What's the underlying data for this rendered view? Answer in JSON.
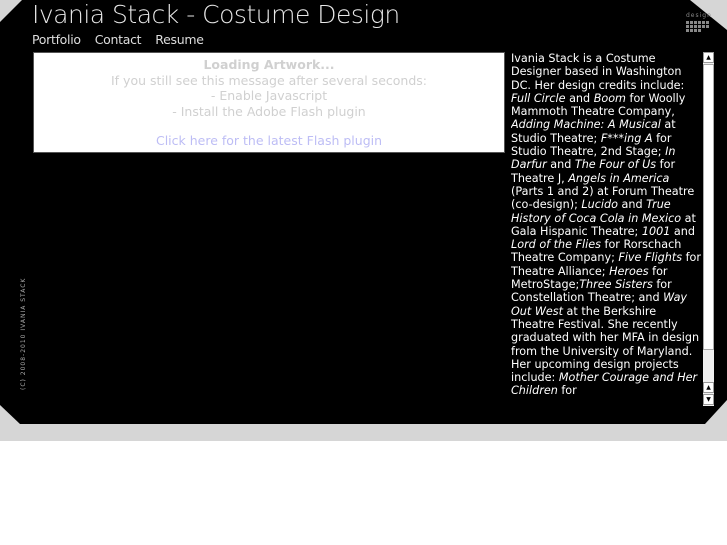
{
  "header": {
    "title": "Ivania Stack - Costume Design",
    "nav": [
      "Portfolio",
      "Contact",
      "Resume"
    ],
    "logo_text": "design"
  },
  "flash": {
    "heading": "Loading Artwork...",
    "line1": "If you still see this message after several seconds:",
    "line2": "- Enable Javascript",
    "line3": "- Install the Adobe Flash plugin",
    "link": "Click here for the latest Flash plugin"
  },
  "copyright": "(C) 2008-2010 IVANIA STACK",
  "bio": [
    {
      "t": "Ivania Stack is a Costume Designer based in Washington DC. Her design credits include: ",
      "i": false
    },
    {
      "t": "Full Circle",
      "i": true
    },
    {
      "t": " and ",
      "i": false
    },
    {
      "t": "Boom",
      "i": true
    },
    {
      "t": " for Woolly Mammoth Theatre Company, ",
      "i": false
    },
    {
      "t": "Adding Machine: A Musical",
      "i": true
    },
    {
      "t": " at Studio Theatre; ",
      "i": false
    },
    {
      "t": "F***ing A",
      "i": true
    },
    {
      "t": " for Studio Theatre, 2nd Stage; ",
      "i": false
    },
    {
      "t": "In Darfur",
      "i": true
    },
    {
      "t": " and ",
      "i": false
    },
    {
      "t": "The Four of Us",
      "i": true
    },
    {
      "t": " for Theatre J, ",
      "i": false
    },
    {
      "t": "Angels in America",
      "i": true
    },
    {
      "t": " (Parts 1 and 2) at Forum Theatre (co-design); ",
      "i": false
    },
    {
      "t": "Lucido",
      "i": true
    },
    {
      "t": " and ",
      "i": false
    },
    {
      "t": "True History of Coca Cola in Mexico",
      "i": true
    },
    {
      "t": " at Gala Hispanic Theatre; ",
      "i": false
    },
    {
      "t": "1001",
      "i": true
    },
    {
      "t": " and ",
      "i": false
    },
    {
      "t": "Lord of the Flies",
      "i": true
    },
    {
      "t": " for Rorschach Theatre Company; ",
      "i": false
    },
    {
      "t": "Five Flights",
      "i": true
    },
    {
      "t": " for Theatre Alliance; ",
      "i": false
    },
    {
      "t": "Heroes",
      "i": true
    },
    {
      "t": " for MetroStage;",
      "i": false
    },
    {
      "t": "Three Sisters",
      "i": true
    },
    {
      "t": " for Constellation Theatre; and ",
      "i": false
    },
    {
      "t": "Way Out West",
      "i": true
    },
    {
      "t": " at the Berkshire Theatre Festival. She recently graduated with her MFA in design from the University of Maryland. Her upcoming design projects include: ",
      "i": false
    },
    {
      "t": "Mother Courage and Her Children",
      "i": true
    },
    {
      "t": " for",
      "i": false
    }
  ]
}
